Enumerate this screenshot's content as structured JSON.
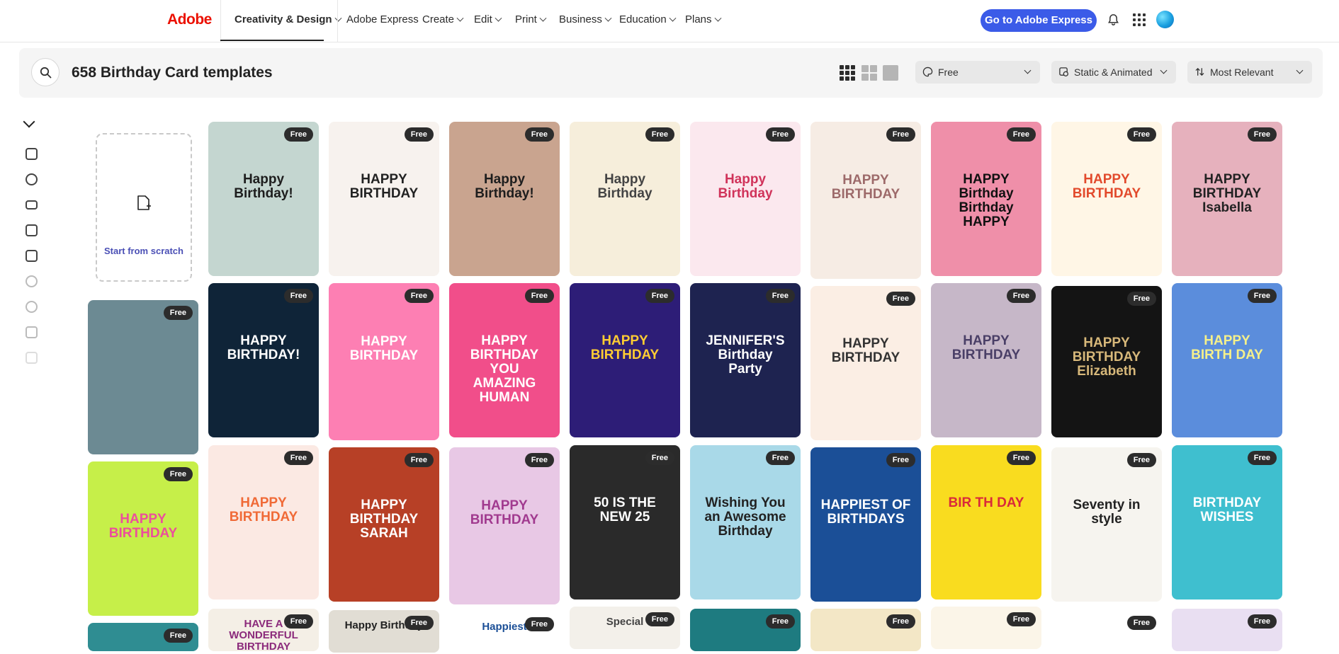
{
  "nav": {
    "logo": "Adobe",
    "items": [
      {
        "label": "Creativity & Design",
        "chevron": true
      },
      {
        "label": "Adobe Express",
        "chevron": false
      },
      {
        "label": "Create",
        "chevron": true
      },
      {
        "label": "Edit",
        "chevron": true
      },
      {
        "label": "Print",
        "chevron": true
      },
      {
        "label": "Business",
        "chevron": true
      },
      {
        "label": "Education",
        "chevron": true
      },
      {
        "label": "Plans",
        "chevron": true
      }
    ],
    "cta": "Go to Adobe Express"
  },
  "search": {
    "title": "658 Birthday Card templates",
    "filters": {
      "price": "Free",
      "type": "Static & Animated",
      "sort": "Most Relevant"
    }
  },
  "start_card": {
    "label": "Start from scratch"
  },
  "badge_label": "Free",
  "templates": [
    {
      "text": "Happy Birthday!",
      "bg": "#c4d6d0",
      "fg": "#1d1d1d"
    },
    {
      "text": "HAPPY BIRTHDAY",
      "bg": "#f7f2ee",
      "fg": "#222222"
    },
    {
      "text": "Happy Birthday!",
      "bg": "#c9a48f",
      "fg": "#1d1d1d"
    },
    {
      "text": "Happy Birthday",
      "bg": "#f6eedb",
      "fg": "#444444"
    },
    {
      "text": "Happy Birthday",
      "bg": "#fbe8ee",
      "fg": "#d0335a"
    },
    {
      "text": "HAPPY BIRTHDAY",
      "bg": "#f6ece4",
      "fg": "#9d6a6a"
    },
    {
      "text": "HAPPY Birthday Birthday HAPPY",
      "bg": "#ef8fa9",
      "fg": "#111111"
    },
    {
      "text": "HAPPY BIRTHDAY",
      "bg": "#fff6e6",
      "fg": "#e24a2c"
    },
    {
      "text": "HAPPY BIRTHDAY Isabella",
      "bg": "#e6b1bd",
      "fg": "#222222"
    },
    {
      "text": "HAPPY BIRTHDAY!",
      "bg": "#0f2438",
      "fg": "#ffffff"
    },
    {
      "text": "HAPPY BIRTHDAY",
      "bg": "#fd7fb3",
      "fg": "#ffffff"
    },
    {
      "text": "HAPPY BIRTHDAY YOU AMAZING HUMAN",
      "bg": "#f14e8a",
      "fg": "#ffffff"
    },
    {
      "text": "HAPPY BIRTHDAY",
      "bg": "#2d1d77",
      "fg": "#ffcc33"
    },
    {
      "text": "JENNIFER'S Birthday Party",
      "bg": "#1e2350",
      "fg": "#ffffff"
    },
    {
      "text": "HAPPY BIRTHDAY",
      "bg": "#fbeee4",
      "fg": "#333333"
    },
    {
      "text": "HAPPY BIRTHDAY",
      "bg": "#c6b7c8",
      "fg": "#4a3f67"
    },
    {
      "text": "HAPPY BIRTHDAY Elizabeth",
      "bg": "#141414",
      "fg": "#d7b87a"
    },
    {
      "text": "HAPPY BIRTH DAY",
      "bg": "#5b8ddc",
      "fg": "#f5f08a"
    },
    {
      "text": "HAPPY BIRTHDAY",
      "bg": "#fbe9e3",
      "fg": "#f06a37"
    },
    {
      "text": "HAPPY BIRTHDAY SARAH",
      "bg": "#b74026",
      "fg": "#ffffff"
    },
    {
      "text": "HAPPY BIRTHDAY",
      "bg": "#e8c8e5",
      "fg": "#a13a8f"
    },
    {
      "text": "50 IS THE NEW 25",
      "bg": "#2a2a2a",
      "fg": "#ffffff"
    },
    {
      "text": "Wishing You an Awesome Birthday",
      "bg": "#a9d9e8",
      "fg": "#222222"
    },
    {
      "text": "HAPPIEST OF BIRTHDAYS",
      "bg": "#1b4f97",
      "fg": "#ffffff"
    },
    {
      "text": "BIR TH DAY",
      "bg": "#f9dc1f",
      "fg": "#d92a3a"
    },
    {
      "text": "Seventy in style",
      "bg": "#f6f4ef",
      "fg": "#222222"
    },
    {
      "text": "BIRTHDAY WISHES",
      "bg": "#3fbfcf",
      "fg": "#ffffff"
    },
    {
      "text": "HAVE A WONDERFUL BIRTHDAY",
      "bg": "#f4efe6",
      "fg": "#8b2a7b"
    },
    {
      "text": "Happy Birthday",
      "bg": "#e1ddd4",
      "fg": "#222222"
    },
    {
      "text": "Happiest",
      "bg": "#ffffff",
      "fg": "#1b4f97"
    },
    {
      "text": "Special",
      "bg": "#f3f0ea",
      "fg": "#444444"
    },
    {
      "text": "",
      "bg": "#1e7b80",
      "fg": "#ffffff"
    },
    {
      "text": "",
      "bg": "#f3e7c6",
      "fg": "#222222"
    },
    {
      "text": "",
      "bg": "#fbf5e8",
      "fg": "#222222"
    },
    {
      "text": "",
      "bg": "#ffffff",
      "fg": "#222222"
    },
    {
      "text": "",
      "bg": "#e9dff2",
      "fg": "#6a2c9e"
    },
    {
      "text": "",
      "bg": "#6c8a93",
      "fg": "#ffffff"
    },
    {
      "text": "HAPPY BIRTHDAY",
      "bg": "#c6ef49",
      "fg": "#ec4e9c"
    },
    {
      "text": "",
      "bg": "#2f8d92",
      "fg": "#ffffff"
    }
  ]
}
